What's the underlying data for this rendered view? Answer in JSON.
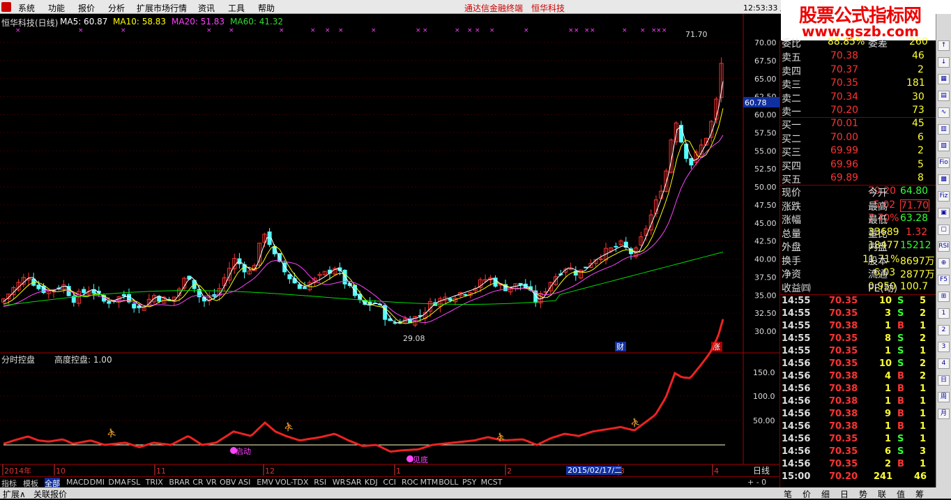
{
  "menu": {
    "items": [
      "系统",
      "功能",
      "报价",
      "分析",
      "扩展市场行情",
      "资讯",
      "工具",
      "帮助"
    ],
    "center": "通达信金融终端　恒华科技",
    "time": "12:53:33 周一"
  },
  "watermark": {
    "line1": "股票公式指标网",
    "line2": "www.gszb.com"
  },
  "chart": {
    "title": "恒华科技(日线)",
    "ma5": "MA5: 60.87",
    "ma10": "MA10: 58.83",
    "ma20": "MA20: 51.83",
    "ma60": "MA60: 41.32",
    "colors": {
      "ma5": "#ffffff",
      "ma10": "#ffff00",
      "ma20": "#ff44ff",
      "ma60": "#00dd00",
      "up": "#ff3333",
      "down": "#54ffff",
      "axis": "#aa0000"
    },
    "price_ticks": [
      "70.00",
      "67.50",
      "65.00",
      "62.50",
      "60.00",
      "57.50",
      "55.00",
      "52.50",
      "50.00",
      "47.50",
      "45.00",
      "42.50",
      "40.00",
      "37.50",
      "35.00",
      "32.50",
      "30.00"
    ],
    "high_label": "71.70",
    "low_label": "29.08",
    "cursor_price": "60.78",
    "badge_cai": "财",
    "badge_zhang": "涨",
    "sub_title": "分时控盘",
    "sub_value": "高度控盘: 1.00",
    "sub_ticks": [
      "150.0",
      "100.0",
      "50.00"
    ],
    "sub_mark_a": "启动",
    "sub_mark_b": "见底",
    "date_labels": [
      "2014年",
      "10",
      "11",
      "12",
      "1",
      "2",
      "3",
      "4"
    ],
    "date_cursor": "2015/02/17/二",
    "period": "日线"
  },
  "quote": {
    "weibi": {
      "label": "委比",
      "value": "88.85%",
      "label2": "委差",
      "value2": "260"
    },
    "sells": [
      {
        "label": "卖五",
        "price": "70.38",
        "vol": "46"
      },
      {
        "label": "卖四",
        "price": "70.37",
        "vol": "2"
      },
      {
        "label": "卖三",
        "price": "70.35",
        "vol": "181"
      },
      {
        "label": "卖二",
        "price": "70.34",
        "vol": "30"
      },
      {
        "label": "卖一",
        "price": "70.20",
        "vol": "73"
      }
    ],
    "buys": [
      {
        "label": "买一",
        "price": "70.01",
        "vol": "45"
      },
      {
        "label": "买二",
        "price": "70.00",
        "vol": "6"
      },
      {
        "label": "买三",
        "price": "69.99",
        "vol": "2"
      },
      {
        "label": "买四",
        "price": "69.96",
        "vol": "5"
      },
      {
        "label": "买五",
        "price": "69.89",
        "vol": "8"
      }
    ],
    "stats": [
      {
        "l1": "现价",
        "v1": "70.20",
        "l2": "今开",
        "v2": "64.80"
      },
      {
        "l1": "涨跌",
        "v1": "5.02",
        "l2": "最高",
        "v2": "71.70"
      },
      {
        "l1": "涨幅",
        "v1": "7.70%",
        "l2": "最低",
        "v2": "63.28"
      },
      {
        "l1": "总量",
        "v1": "33689",
        "l2": "量比",
        "v2": "1.32"
      },
      {
        "l1": "外盘",
        "v1": "18477",
        "l2": "内盘",
        "v2": "15212"
      },
      {
        "l1": "换手",
        "v1": "11.71%",
        "l2": "股本",
        "v2": "8697万"
      },
      {
        "l1": "净资",
        "v1": "6.03",
        "l2": "流通",
        "v2": "2877万"
      },
      {
        "l1": "收益㈣",
        "v1": "0.950",
        "l2": "PE(动)",
        "v2": "100.7"
      }
    ],
    "ticks": [
      {
        "t": "14:55",
        "p": "70.35",
        "v": "10",
        "s": "S",
        "n": "5"
      },
      {
        "t": "14:55",
        "p": "70.35",
        "v": "3",
        "s": "S",
        "n": "2"
      },
      {
        "t": "14:55",
        "p": "70.38",
        "v": "1",
        "s": "B",
        "n": "1"
      },
      {
        "t": "14:55",
        "p": "70.35",
        "v": "8",
        "s": "S",
        "n": "2"
      },
      {
        "t": "14:55",
        "p": "70.35",
        "v": "1",
        "s": "S",
        "n": "1"
      },
      {
        "t": "14:56",
        "p": "70.35",
        "v": "10",
        "s": "S",
        "n": "2"
      },
      {
        "t": "14:56",
        "p": "70.38",
        "v": "4",
        "s": "B",
        "n": "2"
      },
      {
        "t": "14:56",
        "p": "70.38",
        "v": "1",
        "s": "B",
        "n": "1"
      },
      {
        "t": "14:56",
        "p": "70.38",
        "v": "1",
        "s": "B",
        "n": "1"
      },
      {
        "t": "14:56",
        "p": "70.38",
        "v": "9",
        "s": "B",
        "n": "1"
      },
      {
        "t": "14:56",
        "p": "70.38",
        "v": "1",
        "s": "B",
        "n": "1"
      },
      {
        "t": "14:56",
        "p": "70.35",
        "v": "1",
        "s": "S",
        "n": "1"
      },
      {
        "t": "14:56",
        "p": "70.35",
        "v": "6",
        "s": "S",
        "n": "3"
      },
      {
        "t": "14:56",
        "p": "70.35",
        "v": "2",
        "s": "B",
        "n": "1"
      },
      {
        "t": "15:00",
        "p": "70.20",
        "v": "241",
        "s": "",
        "n": "46"
      }
    ]
  },
  "tabs": [
    "指标",
    "模板",
    "全部",
    "MACD",
    "DMI",
    "DMA",
    "FSL",
    "TRIX",
    "BRAR",
    "CR",
    "VR",
    "OBV",
    "ASI",
    "EMV",
    "VOL-TDX",
    "RSI",
    "WR",
    "SAR",
    "KDJ",
    "CCI",
    "ROC",
    "MTM",
    "BOLL",
    "PSY",
    "MCST"
  ],
  "status": {
    "left1": "扩展∧",
    "left2": "关联报价",
    "right_tabs": [
      "笔",
      "价",
      "细",
      "日",
      "势",
      "联",
      "值",
      "筹"
    ]
  },
  "toolstrip": [
    "↑",
    "↓",
    "▦",
    "▤",
    "∿",
    "▥",
    "▧",
    "Fio",
    "▩",
    "Fiz",
    "▣",
    "▢",
    "RSI",
    "⊕",
    "F5",
    "⊞",
    "1",
    "2",
    "3",
    "4",
    "日",
    "周",
    "月"
  ]
}
